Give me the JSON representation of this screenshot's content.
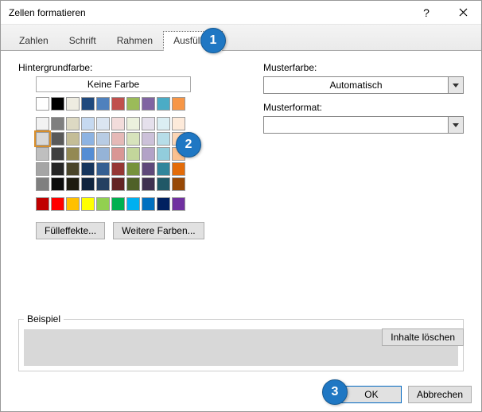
{
  "window": {
    "title": "Zellen formatieren"
  },
  "tabs": {
    "zahlen": "Zahlen",
    "schrift": "Schrift",
    "rahmen": "Rahmen",
    "ausfuellen": "Ausfüllen"
  },
  "labels": {
    "background": "Hintergrundfarbe:",
    "no_color": "Keine Farbe",
    "pattern_color": "Musterfarbe:",
    "pattern_format": "Musterformat:",
    "sample_legend": "Beispiel"
  },
  "combos": {
    "pattern_color_value": "Automatisch",
    "pattern_format_value": ""
  },
  "buttons": {
    "fill_effects": "Fülleffekte...",
    "more_colors": "Weitere Farben...",
    "clear": "Inhalte löschen",
    "ok": "OK",
    "cancel": "Abbrechen"
  },
  "callouts": {
    "c1": "1",
    "c2": "2",
    "c3": "3"
  },
  "palette": {
    "theme_row1": [
      "#ffffff",
      "#000000",
      "#eeece1",
      "#1f497d",
      "#4f81bd",
      "#c0504d",
      "#9bbb59",
      "#8064a2",
      "#4bacc6",
      "#f79646"
    ],
    "tint_rows": [
      [
        "#f2f2f2",
        "#7f7f7f",
        "#ddd9c3",
        "#c6d9f0",
        "#dbe5f1",
        "#f2dcdb",
        "#ebf1dd",
        "#e5e0ec",
        "#dbeef3",
        "#fdeada"
      ],
      [
        "#d8d8d8",
        "#595959",
        "#c4bd97",
        "#8db3e2",
        "#b8cce4",
        "#e5b9b7",
        "#d7e3bc",
        "#ccc1d9",
        "#b7dde8",
        "#fbd5b5"
      ],
      [
        "#bfbfbf",
        "#3f3f3f",
        "#938953",
        "#548dd4",
        "#95b3d7",
        "#d99694",
        "#c3d69b",
        "#b2a2c7",
        "#92cddc",
        "#fac08f"
      ],
      [
        "#a5a5a5",
        "#262626",
        "#494429",
        "#17365d",
        "#366092",
        "#953734",
        "#76923c",
        "#5f497a",
        "#31859b",
        "#e36c09"
      ],
      [
        "#7f7f7f",
        "#0c0c0c",
        "#1d1b10",
        "#0f243e",
        "#244061",
        "#632423",
        "#4f6128",
        "#3f3151",
        "#205867",
        "#974806"
      ]
    ],
    "standard": [
      "#c00000",
      "#ff0000",
      "#ffc000",
      "#ffff00",
      "#92d050",
      "#00b050",
      "#00b0f0",
      "#0070c0",
      "#002060",
      "#7030a0"
    ]
  }
}
